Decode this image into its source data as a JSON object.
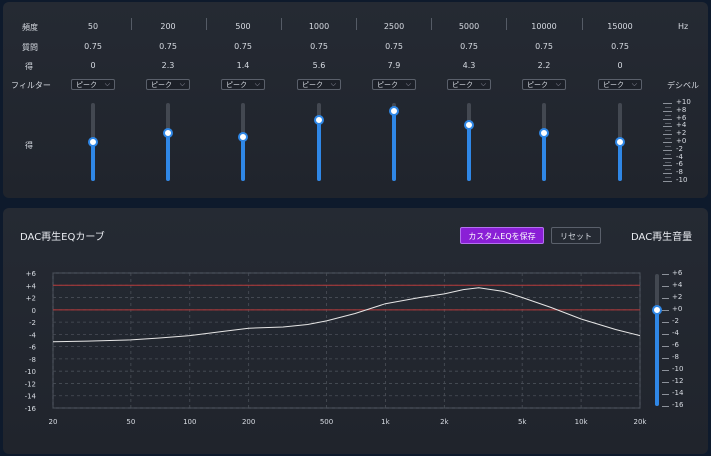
{
  "eq_table": {
    "freq_label": "頻度",
    "q_label": "質問",
    "gain_label": "得",
    "filter_label": "フィルター",
    "slider_row_label": "得",
    "hz_unit": "Hz",
    "db_unit": "デシベル",
    "bands": [
      {
        "freq": "50",
        "q": "0.75",
        "gain": "0",
        "filter": "ピーク"
      },
      {
        "freq": "200",
        "q": "0.75",
        "gain": "2.3",
        "filter": "ピーク"
      },
      {
        "freq": "500",
        "q": "0.75",
        "gain": "1.4",
        "filter": "ピーク"
      },
      {
        "freq": "1000",
        "q": "0.75",
        "gain": "5.6",
        "filter": "ピーク"
      },
      {
        "freq": "2500",
        "q": "0.75",
        "gain": "7.9",
        "filter": "ピーク"
      },
      {
        "freq": "5000",
        "q": "0.75",
        "gain": "4.3",
        "filter": "ピーク"
      },
      {
        "freq": "10000",
        "q": "0.75",
        "gain": "2.2",
        "filter": "ピーク"
      },
      {
        "freq": "15000",
        "q": "0.75",
        "gain": "0",
        "filter": "ピーク"
      }
    ],
    "db_scale": [
      "+10",
      "+8",
      "+6",
      "+4",
      "+2",
      "+0",
      "-2",
      "-4",
      "-6",
      "-8",
      "-10"
    ],
    "slider_range": [
      -10,
      10
    ]
  },
  "curve_panel": {
    "title": "DAC再生EQカーブ",
    "save_button": "カスタムEQを保存",
    "reset_button": "リセット",
    "volume_title": "DAC再生音量",
    "volume_scale": [
      "+6",
      "+4",
      "+2",
      "+0",
      "-2",
      "-4",
      "-6",
      "-8",
      "-10",
      "-12",
      "-14",
      "-16"
    ],
    "volume_range": [
      -16,
      6
    ],
    "volume_value": 0
  },
  "chart_data": {
    "type": "line",
    "x_scale": "log",
    "xlim": [
      20,
      20000
    ],
    "ylim": [
      -16,
      6
    ],
    "x_ticks": [
      20,
      50,
      100,
      200,
      500,
      1000,
      2000,
      5000,
      10000,
      20000
    ],
    "x_tick_labels": [
      "20",
      "50",
      "100",
      "200",
      "500",
      "1k",
      "2k",
      "5k",
      "10k",
      "20k"
    ],
    "y_tick_labels": [
      "+6",
      "+4",
      "+2",
      "0",
      "-2",
      "-4",
      "-6",
      "-8",
      "-10",
      "-12",
      "-14",
      "-16"
    ],
    "grid": true,
    "reference_lines": [
      4,
      0
    ],
    "series": [
      {
        "x": [
          20,
          30,
          50,
          70,
          100,
          150,
          200,
          300,
          400,
          500,
          700,
          1000,
          1500,
          2000,
          2500,
          3000,
          4000,
          5000,
          7000,
          10000,
          15000,
          20000
        ],
        "y": [
          -5.2,
          -5.1,
          -4.9,
          -4.6,
          -4.2,
          -3.5,
          -3.0,
          -2.8,
          -2.4,
          -1.8,
          -0.6,
          1.0,
          2.0,
          2.6,
          3.3,
          3.6,
          3.0,
          2.0,
          0.4,
          -1.5,
          -3.2,
          -4.2
        ]
      }
    ],
    "colors": {
      "curve": "#e6e6e6",
      "reference": "#b83a3a",
      "grid": "#4a4f58"
    }
  }
}
